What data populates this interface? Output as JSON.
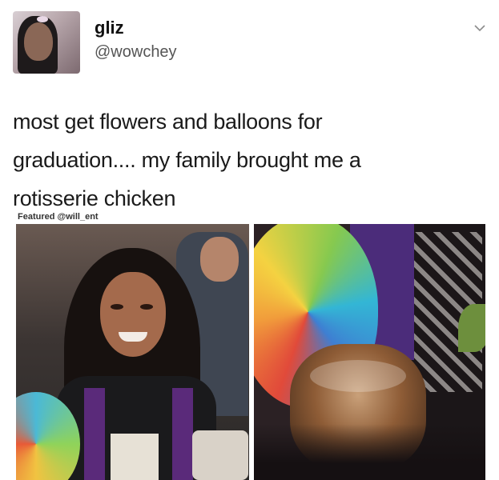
{
  "tweet": {
    "display_name": "gliz",
    "handle": "@wowchey",
    "text_lines": [
      "most get flowers and balloons for",
      "graduation.... my family brought me a",
      "rotisserie chicken"
    ]
  },
  "media": {
    "featured_credit": "Featured @will_ent",
    "left_photo": "graduate-selfie-photo",
    "right_photo": "balloon-and-rotisserie-chicken-photo"
  },
  "icons": {
    "menu": "chevron-down-icon",
    "avatar": "avatar"
  },
  "colors": {
    "text": "#1c1c1c",
    "handle": "#555555",
    "background": "#ffffff"
  }
}
